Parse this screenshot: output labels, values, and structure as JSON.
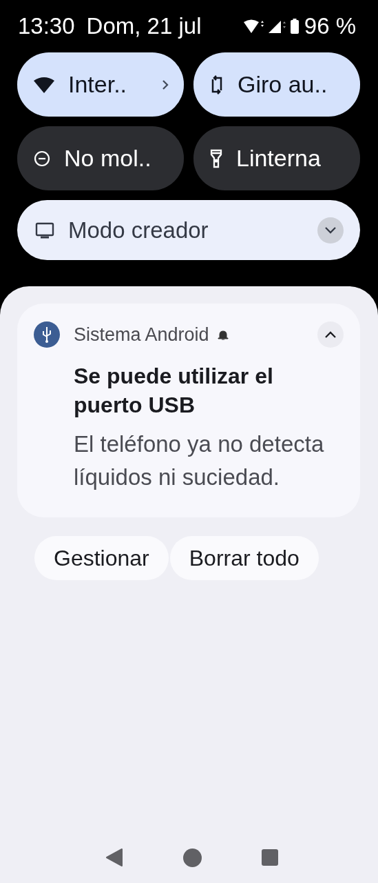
{
  "status_bar": {
    "time": "13:30",
    "date": "Dom, 21 jul",
    "battery": "96 %"
  },
  "tiles": [
    {
      "kind": "wifi",
      "label": "Inter..",
      "on": true,
      "has_chevron": true
    },
    {
      "kind": "rotate",
      "label": "Giro au..",
      "on": true,
      "has_chevron": false
    },
    {
      "kind": "dnd",
      "label": "No mol..",
      "on": false,
      "has_chevron": false
    },
    {
      "kind": "flashlight",
      "label": "Linterna",
      "on": false,
      "has_chevron": false
    }
  ],
  "media": {
    "label": "Modo creador",
    "expanded": false
  },
  "notification": {
    "app": "Sistema Android",
    "title": "Se puede utilizar el puerto USB",
    "body": "El teléfono ya no detecta líquidos ni suciedad.",
    "expanded": true
  },
  "actions": [
    "Gestionar",
    "Borrar todo"
  ]
}
